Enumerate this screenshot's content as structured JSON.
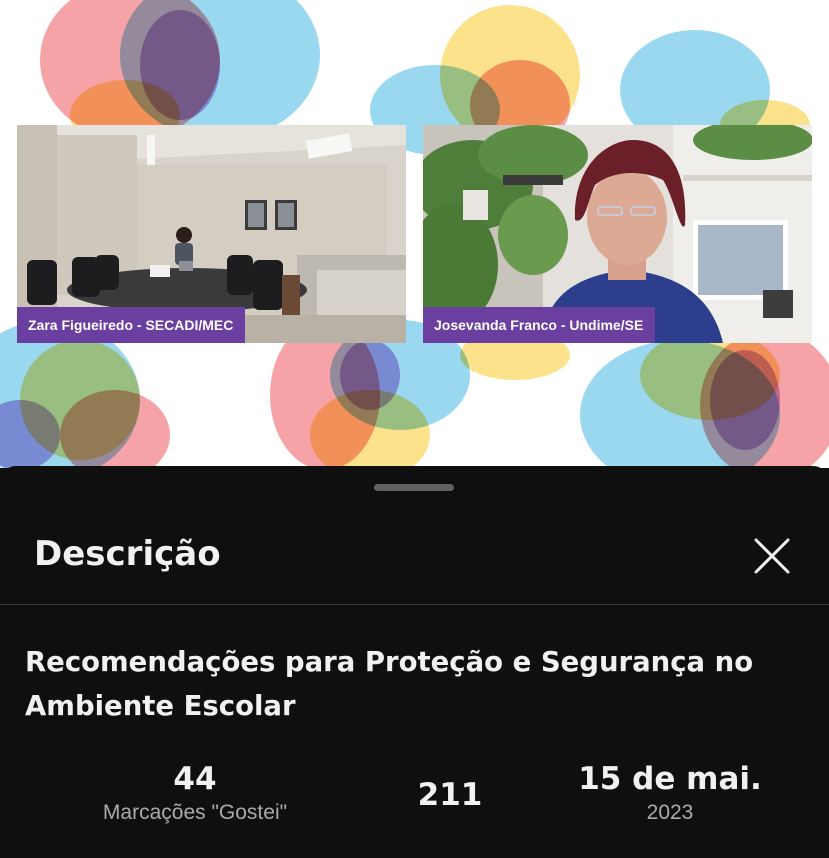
{
  "participants": [
    {
      "label": "Zara Figueiredo - SECADI/MEC"
    },
    {
      "label": "Josevanda Franco - Undime/SE"
    }
  ],
  "sheet": {
    "title": "Descrição",
    "close_icon": "close-icon",
    "video_title": "Recomendações para Proteção e Segurança no Ambiente Escolar",
    "stats": {
      "likes": {
        "value": "44",
        "label": "Marcações \"Gostei\""
      },
      "views": {
        "value": "211"
      },
      "date": {
        "value": "15 de mai.",
        "label": "2023"
      }
    }
  },
  "colors": {
    "sheet_bg": "#0f0f0f",
    "label_bg": "#6a3fa0",
    "text_primary": "#f1f1f1",
    "text_secondary": "#aaaaaa"
  }
}
